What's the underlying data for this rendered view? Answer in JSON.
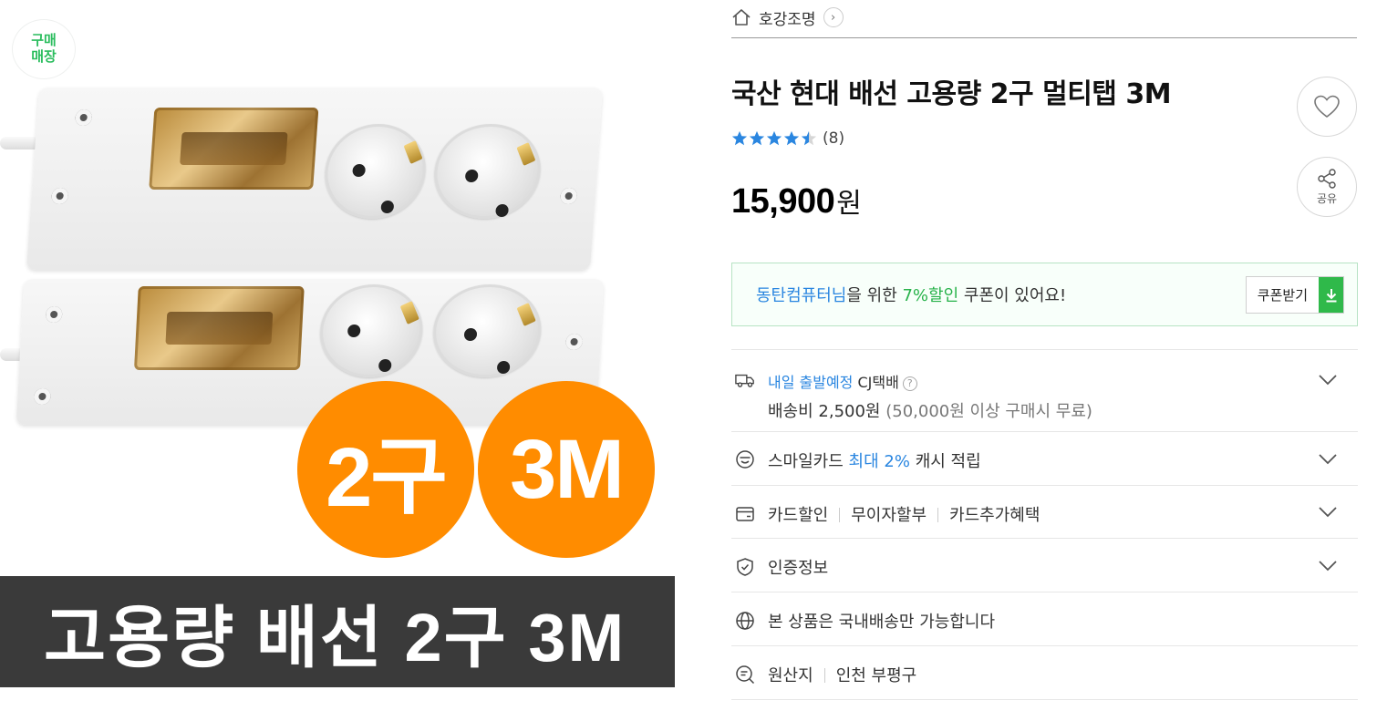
{
  "image": {
    "store_badge": [
      "구매",
      "매장"
    ],
    "circle_left": "2구",
    "circle_right": "3M",
    "banner_text": "고용량 배선 2구 3M"
  },
  "store": {
    "name": "호강조명",
    "home_icon": "home-icon",
    "chevron": "›"
  },
  "product": {
    "title": "국산 현대 배선 고용량 2구 멀티탭 3M",
    "rating": 4.5,
    "review_count": "(8)",
    "price": "15,900",
    "price_unit": "원"
  },
  "actions": {
    "share_label": "공유"
  },
  "coupon": {
    "user_name": "동탄컴퓨터님",
    "text_mid": "을 위한 ",
    "discount": "7%할인",
    "text_end": " 쿠폰이 있어요!",
    "button_label": "쿠폰받기"
  },
  "shipping": {
    "eta": "내일 출발예정",
    "carrier": "CJ택배",
    "help": "?",
    "fee": "배송비 2,500원",
    "free_cond": "(50,000원 이상 구매시 무료)"
  },
  "smilecard": {
    "prefix": "스마일카드",
    "highlight": "최대 2%",
    "suffix": "캐시 적립"
  },
  "card": {
    "items": [
      "카드할인",
      "무이자할부",
      "카드추가혜택"
    ]
  },
  "certification": {
    "label": "인증정보"
  },
  "domestic": {
    "label": "본 상품은 국내배송만 가능합니다"
  },
  "origin": {
    "label": "원산지",
    "value": "인천 부평구"
  },
  "colors": {
    "accent_blue": "#2a86e0",
    "accent_green": "#27b24a",
    "badge_orange": "#ff8c00",
    "banner_dark": "#3a3a3a"
  }
}
